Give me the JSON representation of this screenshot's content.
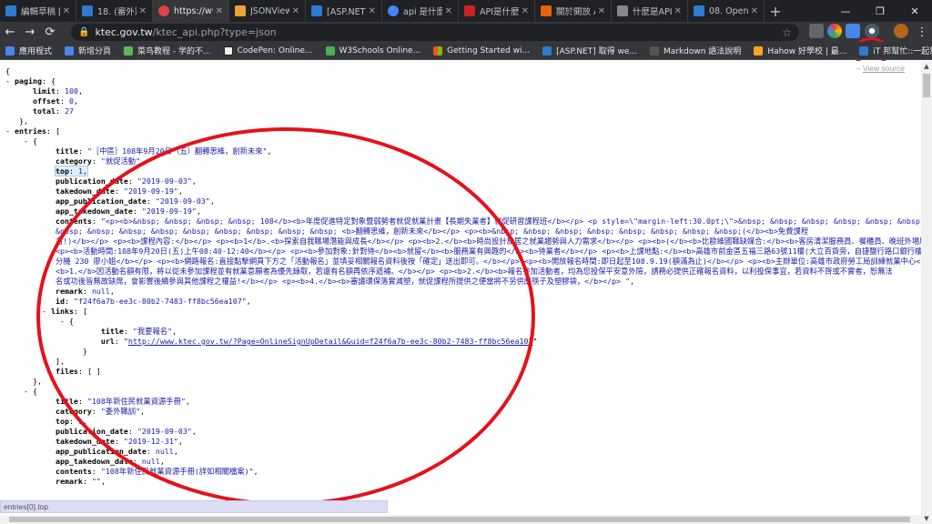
{
  "tabs": [
    {
      "title": "編輯草稿 [A",
      "color": "#2e7bcf"
    },
    {
      "title": "18. (審外篇)",
      "color": "#2e7bcf"
    },
    {
      "title": "https://ww",
      "color": "#d44",
      "active": true
    },
    {
      "title": "JSONView",
      "color": "#e8a33c"
    },
    {
      "title": "[ASP.NET] 取",
      "color": "#2e7bcf"
    },
    {
      "title": "api 是什麼",
      "color": "#4285f4"
    },
    {
      "title": "API是什麼?",
      "color": "#c22"
    },
    {
      "title": "關於開放 AI",
      "color": "#e8630a"
    },
    {
      "title": "什麼是API?",
      "color": "#888"
    },
    {
      "title": "08. Open d",
      "color": "#2e7bcf"
    }
  ],
  "window_controls": {
    "minimize": "—",
    "restore": "❐",
    "close": "✕"
  },
  "toolbar": {
    "back": "←",
    "forward": "→",
    "reload": "⟳",
    "url_host": "ktec.gov.tw",
    "url_path": "/ktec_api.php?type=json",
    "star": "☆"
  },
  "bookmarks": [
    {
      "label": "應用程式",
      "color": "#4a86e8"
    },
    {
      "label": "新增分頁",
      "color": "#4a86e8"
    },
    {
      "label": "菜鸟教程 - 学的不...",
      "color": "#5cb85c"
    },
    {
      "label": "CodePen: Online...",
      "color": "#222"
    },
    {
      "label": "W3Schools Online...",
      "color": "#4caf50"
    },
    {
      "label": "Getting Started wi...",
      "color": "#f25022"
    },
    {
      "label": "[ASP.NET] 取得 we...",
      "color": "#2e7bcf"
    },
    {
      "label": "Markdown 語法說明",
      "color": "#555"
    },
    {
      "label": "Hahow 好學校 | 最...",
      "color": "#f5a623"
    },
    {
      "label": "iT 邦幫忙::一起幫忙...",
      "color": "#2e7bcf"
    }
  ],
  "view_source": "View source",
  "json": {
    "open_brace": "{",
    "paging_key": "paging",
    "limit_key": "limit",
    "limit": "100",
    "offset_key": "offset",
    "offset": "0",
    "total_key": "total",
    "total": "27",
    "entries_key": "entries",
    "e1": {
      "title": "\"［中區］108年9月20日（五）翻轉思維，創新未來\"",
      "category": "\"就促活動\"",
      "top": "1",
      "publication_date": "\"2019-09-03\"",
      "takedown_date": "\"2019-09-19\"",
      "app_publication_date": "\"2019-09-03\"",
      "app_takedown_date": "\"2019-09-19\"",
      "contents_l1": "\"<p><b>&nbsp; &nbsp; &nbsp; &nbsp; 108</b><b>年度促進特定對象暨弱勢者就促就業計畫【長期失業者】就促研習課程班</b></p> <p style=\\\"margin-left:30.0pt;\\\">&nbsp; &nbsp; &nbsp; &nbsp; &nbsp; &nbsp; &",
      "contents_l2": "&nbsp; &nbsp; &nbsp; &nbsp; &nbsp; &nbsp; &nbsp; &nbsp; &nbsp; <b>翻轉思維，創新未來</b></p> <p><b>&nbsp; &nbsp; &nbsp; &nbsp; &nbsp; &nbsp; &nbsp; &nbsp;(</b><b>免費課程",
      "contents_l3": "名!)</b></p> <p><b>課程內容:</b></p> <p><b>1</b>.<b>探索自我職場潛能與成長</b></p> <p><b>2.</b><b>時尚設計旅居之就業趨勢與人力需求</b></p> <p><b>(</b><b>比歐維國職缺媒合:</b><b>客房清潔服務員、餐櫃員、晚班外場服",
      "contents_l4": "<p><b>活動時間:108年9月20日(五)上午08:40-12:40</b></p> <p><b>參加對象:針對待</b><b>就留</b><b>服務業有興趣的</b><b>待業者</b></p> <p><b>上課地點:</b><b>高雄市前金區五福三路63號11樓(大立百貨旁，自捷鹽行路口銀行樓上",
      "contents_l5": "分機 230 廖小姐</b></p> <p><b>網路報名:直接點擊網頁下方之「活動報名」並填妥相關報名資料後按「確定」送出即可。</b></p> <p><b>開放報名時間:即日起至108.9.19(額滿為止)</b></p> <p><b>主辦單位:高雄市政府勞工局訓練就業中心</",
      "contents_l6": "<b>1.</b>因活動名額有限，將以從未參加課程並有就業意願者為優先錄取，若還有名額再依序遞補。</b></p> <p><b>2.</b><b>報名參加活動者，均為您投保平安意外險，請務必提供正確報名資料，以利投保事宜，若資料不齊或不實者，恕無法",
      "contents_l7": "名或功後皆無故缺席，會影響後續參與其他課程之權益!</b></p> <p><b>4.</b><b>審議環保落實減塑，就促課程所提供之便當將不另供應筷子及塑膠袋，</b></p> \"",
      "remark": "null",
      "id": "\"f24f6a7b-ee3c-80b2-7483-ff8bc56ea107\"",
      "link_title": "\"我要報名\"",
      "link_url": "http://www.ktec.gov.tw/?Page=OnlineSignUpDetail&Guid=f24f6a7b-ee3c-80b2-7483-ff8bc56ea107",
      "files": "[ ]"
    },
    "e2": {
      "title": "\"108年新住民就業資源手冊\"",
      "category": "\"委外職訓\"",
      "top": "1",
      "publication_date": "\"2019-09-03\"",
      "takedown_date": "\"2019-12-31\"",
      "app_publication_date": "null",
      "app_takedown_date": "null",
      "contents": "\"108年新住民就業資源手冊(詳如相關檔案)\"",
      "remark": "\"\""
    }
  },
  "status": "entries[0].top"
}
